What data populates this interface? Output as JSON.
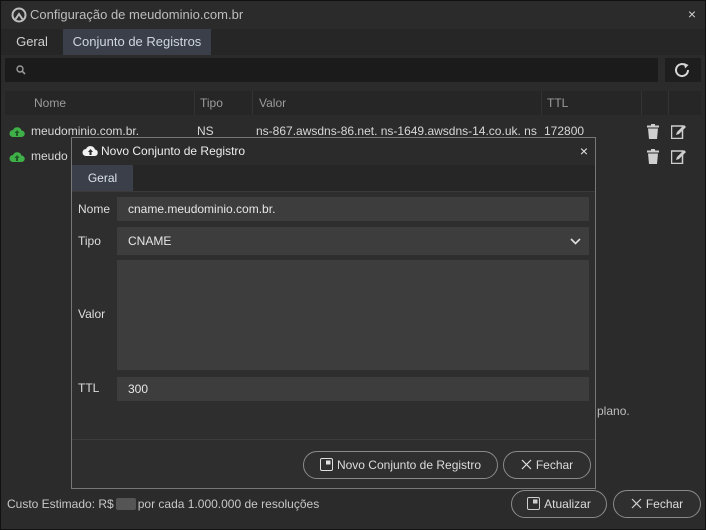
{
  "window": {
    "title": "Configuração de meudominio.com.br",
    "close_glyph": "×"
  },
  "tabs": [
    {
      "label": "Geral",
      "active": false
    },
    {
      "label": "Conjunto de Registros",
      "active": true
    }
  ],
  "search": {
    "placeholder": "",
    "icon": "search-icon"
  },
  "table": {
    "columns": [
      "Nome",
      "Tipo",
      "Valor",
      "TTL"
    ],
    "rows": [
      {
        "name": "meudominio.com.br.",
        "type": "NS",
        "value": "ns-867.awsdns-86.net. ns-1649.awsdns-14.co.uk. ns",
        "ttl": "172800"
      },
      {
        "name": "meudo",
        "type": "",
        "value": "",
        "ttl": ""
      }
    ]
  },
  "background_text": "plano.",
  "footer": {
    "label": "Custo Estimado:",
    "currency": "R$",
    "suffix": "por cada 1.000.000 de resoluções",
    "update_button": "Atualizar",
    "close_button": "Fechar"
  },
  "modal": {
    "title": "Novo Conjunto de Registro",
    "close_glyph": "×",
    "tab": "Geral",
    "fields": {
      "name_label": "Nome",
      "name_value": "cname.meudominio.com.br.",
      "type_label": "Tipo",
      "type_value": "CNAME",
      "value_label": "Valor",
      "value_value": "",
      "ttl_label": "TTL",
      "ttl_value": "300"
    },
    "buttons": {
      "create": "Novo Conjunto de Registro",
      "close": "Fechar"
    }
  },
  "colors": {
    "background": "#2b2b2b",
    "active_tab": "#3a3f4a",
    "cloud_green": "#3faf47",
    "field_bg": "#3d3d3d"
  }
}
